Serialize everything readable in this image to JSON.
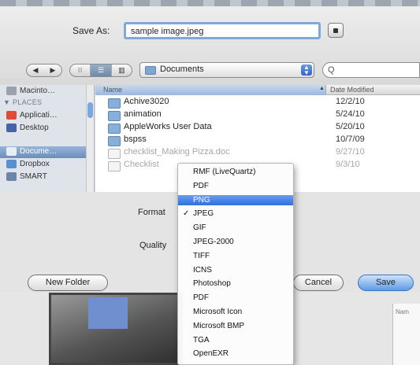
{
  "dialog": {
    "save_as_label": "Save As:",
    "filename": "sample image.jpeg"
  },
  "toolbar": {
    "back": "◀",
    "forward": "▶",
    "view_icon_1": "⁝⁝",
    "view_icon_2": "☰",
    "view_icon_3": "▥",
    "location": "Documents",
    "search_placeholder": "Q"
  },
  "sidebar": {
    "top_item": "Macinto…",
    "places_heading": "▼ PLACES",
    "items": [
      {
        "label": "Applicati…",
        "color": "#e04a3a"
      },
      {
        "label": "Desktop",
        "color": "#4464a8"
      },
      {
        "label": "Docume…",
        "color": "#8aa6c8"
      },
      {
        "label": "Dropbox",
        "color": "#5a8fd0"
      },
      {
        "label": "SMART",
        "color": "#6b86a8"
      }
    ]
  },
  "file_list": {
    "col_name": "Name",
    "col_date": "Date Modified",
    "sort_arrow": "▲",
    "rows": [
      {
        "name": "Achive3020",
        "date": "12/2/10",
        "kind": "folder",
        "dim": false
      },
      {
        "name": "animation",
        "date": "5/24/10",
        "kind": "folder",
        "dim": false
      },
      {
        "name": "AppleWorks User Data",
        "date": "5/20/10",
        "kind": "folder",
        "dim": false
      },
      {
        "name": "bspss",
        "date": "10/7/09",
        "kind": "folder",
        "dim": false
      },
      {
        "name": "checklist_Making Pizza.doc",
        "date": "9/27/10",
        "kind": "doc",
        "dim": true
      },
      {
        "name": "Checklist",
        "date": "9/3/10",
        "kind": "doc",
        "dim": true
      }
    ]
  },
  "options": {
    "format_label": "Format",
    "quality_label": "Quality"
  },
  "buttons": {
    "new_folder": "New Folder",
    "cancel": "Cancel",
    "save": "Save"
  },
  "format_menu": {
    "checked_mark": "✓",
    "items": [
      {
        "label": "RMF (LiveQuartz)",
        "selected": false,
        "highlighted": false
      },
      {
        "label": "PDF",
        "selected": false,
        "highlighted": false
      },
      {
        "label": "PNG",
        "selected": false,
        "highlighted": true
      },
      {
        "label": "JPEG",
        "selected": true,
        "highlighted": false
      },
      {
        "label": "GIF",
        "selected": false,
        "highlighted": false
      },
      {
        "label": "JPEG-2000",
        "selected": false,
        "highlighted": false
      },
      {
        "label": "TIFF",
        "selected": false,
        "highlighted": false
      },
      {
        "label": "ICNS",
        "selected": false,
        "highlighted": false
      },
      {
        "label": "Photoshop",
        "selected": false,
        "highlighted": false
      },
      {
        "label": "PDF",
        "selected": false,
        "highlighted": false
      },
      {
        "label": "Microsoft Icon",
        "selected": false,
        "highlighted": false
      },
      {
        "label": "Microsoft BMP",
        "selected": false,
        "highlighted": false
      },
      {
        "label": "TGA",
        "selected": false,
        "highlighted": false
      },
      {
        "label": "OpenEXR",
        "selected": false,
        "highlighted": false
      }
    ]
  },
  "background": {
    "side_label": "Nam"
  },
  "colors": {
    "accent": "#3a78dc",
    "selection": "#7fa7d8"
  }
}
